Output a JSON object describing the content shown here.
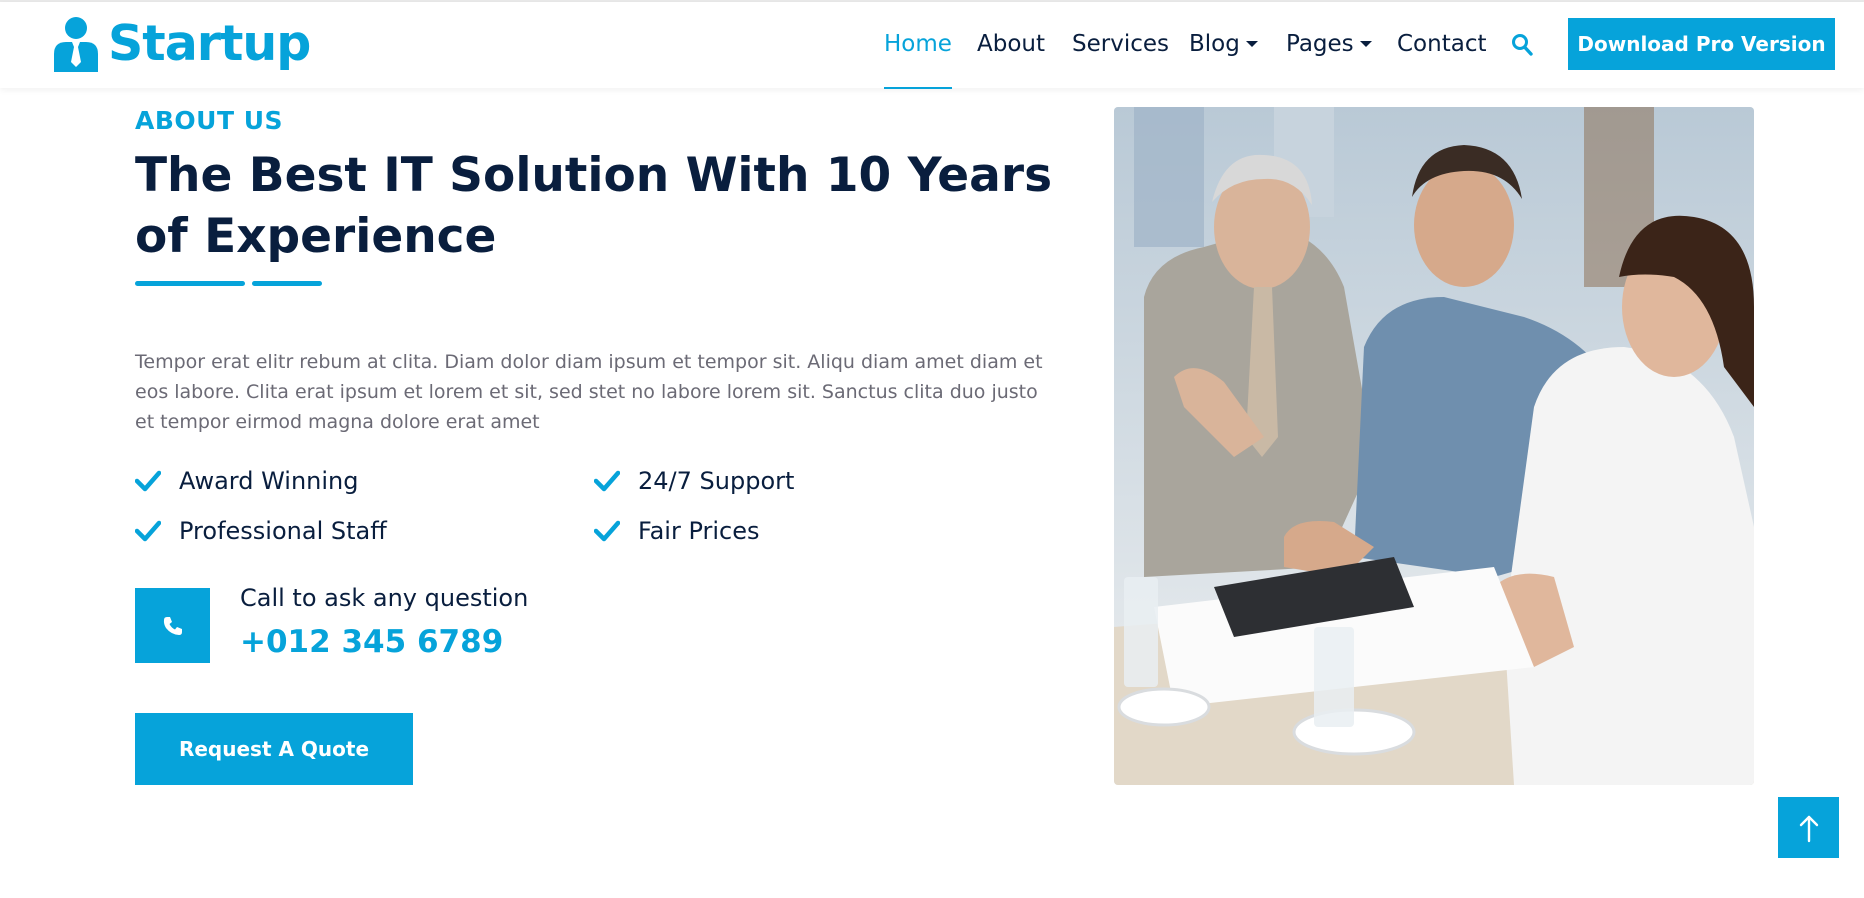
{
  "brand": {
    "name": "Startup",
    "icon": "user-tie-icon"
  },
  "nav": {
    "items": [
      {
        "label": "Home",
        "active": true
      },
      {
        "label": "About"
      },
      {
        "label": "Services"
      },
      {
        "label": "Blog",
        "dropdown": true
      },
      {
        "label": "Pages",
        "dropdown": true
      },
      {
        "label": "Contact"
      }
    ],
    "search_icon": "search-icon",
    "cta_label": "Download Pro Version"
  },
  "about": {
    "eyebrow": "ABOUT US",
    "headline": "The Best IT Solution With 10 Years of Experience",
    "paragraph": "Tempor erat elitr rebum at clita. Diam dolor diam ipsum et tempor sit. Aliqu diam amet diam et eos labore. Clita erat ipsum et lorem et sit, sed stet no labore lorem sit. Sanctus clita duo justo et tempor eirmod magna dolore erat amet",
    "features": [
      "Award Winning",
      "24/7 Support",
      "Professional Staff",
      "Fair Prices"
    ],
    "call_label": "Call to ask any question",
    "phone": "+012 345 6789",
    "quote_label": "Request A Quote"
  },
  "image": {
    "subject": "business-meeting-photo"
  },
  "colors": {
    "primary": "#06a3da",
    "dark": "#091e3e",
    "muted": "#6b6a75"
  },
  "back_to_top_icon": "arrow-up-icon"
}
